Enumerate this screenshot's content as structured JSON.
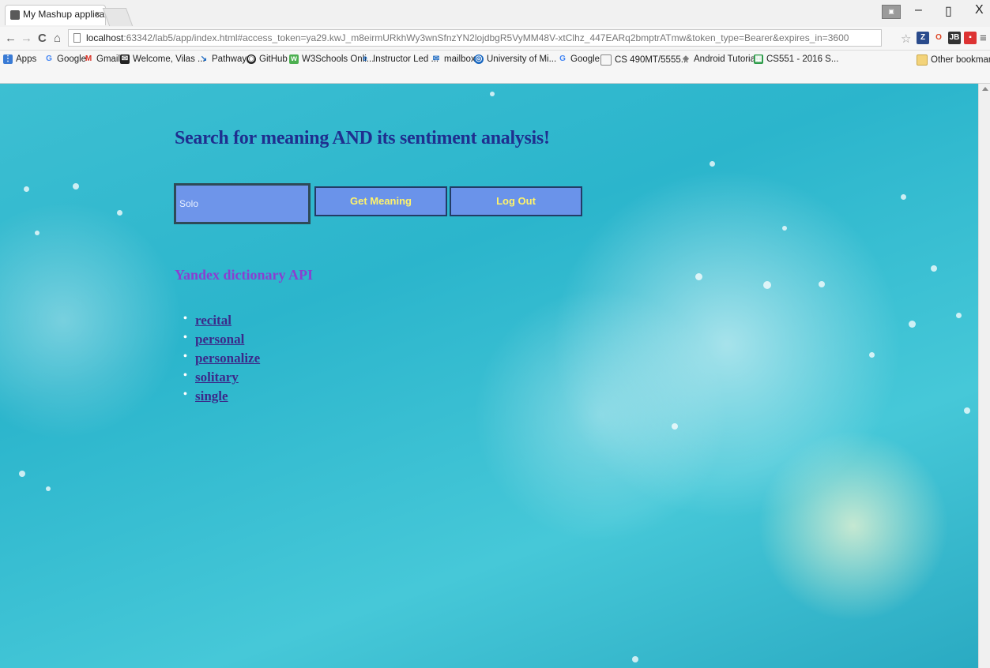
{
  "browser": {
    "tab_title": "My Mashup applicati",
    "tab_close": "×",
    "window_controls": {
      "minimize": "–",
      "maximize": "▯",
      "close": "X"
    },
    "url_host": "localhost",
    "url_rest": ":63342/lab5/app/index.html#access_token=ya29.kwJ_m8eirmURkhWy3wnSfnzYN2lojdbgR5VyMM48V-xtClhz_447EARq2bmptrATmw&token_type=Bearer&expires_in=3600",
    "bookmarks": [
      "Apps",
      "Google",
      "Gmail",
      "Welcome, Vilas ...",
      "Pathway",
      "GitHub",
      "W3Schools Onli...",
      "Instructor Led ...",
      "mailbox",
      "University of Mi...",
      "Google",
      "CS 490MT/5555...",
      "Android Tutorial",
      "CS551 - 2016 S..."
    ],
    "other_bookmarks": "Other bookmarks"
  },
  "page": {
    "heading": "Search for meaning AND its sentiment analysis!",
    "search_value": "Solo",
    "get_meaning_label": "Get Meaning",
    "logout_label": "Log Out",
    "api_title": "Yandex dictionary API",
    "synonyms": [
      "recital",
      "personal",
      "personalize",
      "solitary",
      "single"
    ]
  },
  "colors": {
    "heading": "#1f2f8f",
    "button_bg": "#6a93ea",
    "button_text": "#fff36a",
    "api_title": "#8a3fd0",
    "link": "#3b2a8a"
  }
}
